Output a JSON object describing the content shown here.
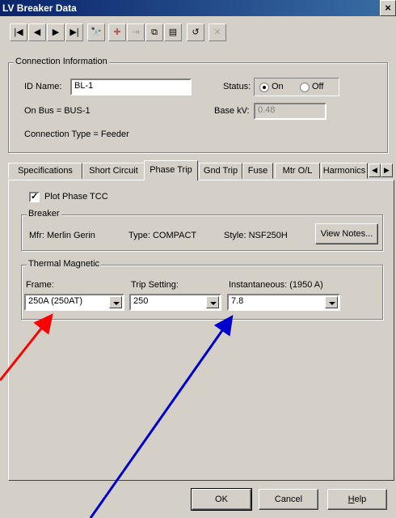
{
  "window": {
    "title": "LV Breaker Data",
    "close_glyph": "×"
  },
  "toolbar": {
    "buttons": [
      {
        "icon": "first-record-icon",
        "glyph": "|◀"
      },
      {
        "icon": "previous-record-icon",
        "glyph": "◀"
      },
      {
        "icon": "next-record-icon",
        "glyph": "▶"
      },
      {
        "icon": "last-record-icon",
        "glyph": "▶|"
      },
      {
        "icon": "binoculars-icon",
        "glyph": "🔭"
      },
      {
        "icon": "add-icon",
        "glyph": "✚"
      },
      {
        "icon": "insert-icon",
        "glyph": "⇥"
      },
      {
        "icon": "copy-icon",
        "glyph": "⧉"
      },
      {
        "icon": "paste-icon",
        "glyph": "▤"
      },
      {
        "icon": "undo-icon",
        "glyph": "↺"
      },
      {
        "icon": "delete-icon",
        "glyph": "✕"
      }
    ]
  },
  "connection": {
    "group_title": "Connection Information",
    "id_label": "ID Name:",
    "id_value": "BL-1",
    "status_label": "Status:",
    "status_on": "On",
    "status_off": "Off",
    "on_bus": "On Bus = BUS-1",
    "base_kv_label": "Base kV:",
    "base_kv_value": "0.48",
    "connection_type": "Connection Type =  Feeder"
  },
  "tabs": [
    {
      "label": "Specifications"
    },
    {
      "label": "Short Circuit"
    },
    {
      "label": "Phase Trip"
    },
    {
      "label": "Gnd Trip"
    },
    {
      "label": "Fuse"
    },
    {
      "label": "Mtr O/L"
    },
    {
      "label": "Harmonics"
    }
  ],
  "phase_trip": {
    "plot_label": "Plot Phase TCC",
    "plot_checked": "✓",
    "breaker_group": "Breaker",
    "mfr": "Mfr:  Merlin Gerin",
    "type": "Type:  COMPACT",
    "style": "Style:  NSF250H",
    "view_notes": "View Notes...",
    "thermal_group": "Thermal Magnetic",
    "frame_label": "Frame:",
    "frame_value": "250A (250AT)",
    "trip_label": "Trip Setting:",
    "trip_value": "250",
    "inst_label": "Instantaneous: (1950 A)",
    "inst_value": "7.8"
  },
  "buttons": {
    "ok": "OK",
    "cancel": "Cancel",
    "help": "Help"
  },
  "arrows": {
    "red": "#ff0000",
    "blue": "#0000cc"
  }
}
